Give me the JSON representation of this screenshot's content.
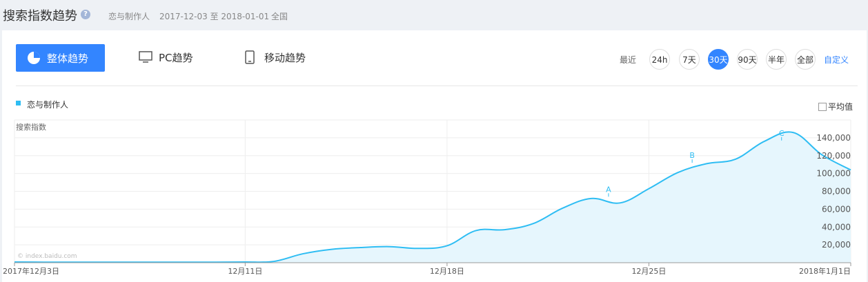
{
  "header": {
    "title": "搜索指数趋势",
    "help_icon": "?",
    "keyword": "恋与制作人",
    "date_range": "2017-12-03 至 2018-01-01",
    "region": "全国"
  },
  "tabs": {
    "overall": "整体趋势",
    "pc": "PC趋势",
    "mobile": "移动趋势"
  },
  "range": {
    "label": "最近",
    "options": [
      "24h",
      "7天",
      "30天",
      "90天",
      "半年",
      "全部"
    ],
    "active": "30天",
    "custom": "自定义"
  },
  "legend": {
    "series": "恋与制作人"
  },
  "average_toggle": {
    "label": "平均值",
    "checked": false
  },
  "watermark": "© index.baidu.com",
  "colors": {
    "accent": "#3385ff",
    "series": "#2ebdf3",
    "fill": "#e6f6fd"
  },
  "chart_data": {
    "type": "area",
    "ylabel": "搜索指数",
    "ylim": [
      0,
      160000
    ],
    "yticks": [
      "20,000",
      "40,000",
      "60,000",
      "80,000",
      "100,000",
      "120,000",
      "140,000"
    ],
    "ytick_values": [
      20000,
      40000,
      60000,
      80000,
      100000,
      120000,
      140000
    ],
    "xlabels": [
      {
        "day": 0,
        "label": "2017年12月3日"
      },
      {
        "day": 8,
        "label": "12月11日"
      },
      {
        "day": 15,
        "label": "12月18日"
      },
      {
        "day": 22,
        "label": "12月25日"
      },
      {
        "day": 29,
        "label": "2018年1月1日"
      }
    ],
    "series": [
      {
        "name": "恋与制作人",
        "values": [
          800,
          600,
          600,
          600,
          600,
          600,
          600,
          600,
          800,
          1500,
          10000,
          15000,
          17000,
          18000,
          16000,
          19000,
          36000,
          37000,
          44000,
          61000,
          72000,
          67000,
          83000,
          101000,
          111000,
          116000,
          136000,
          146000,
          121000,
          104000
        ]
      }
    ],
    "annotations": [
      {
        "label": "A",
        "day": 20.6,
        "value": 74000
      },
      {
        "label": "B",
        "day": 23.5,
        "value": 112000
      },
      {
        "label": "C",
        "day": 26.6,
        "value": 137000
      }
    ],
    "grid": true
  }
}
